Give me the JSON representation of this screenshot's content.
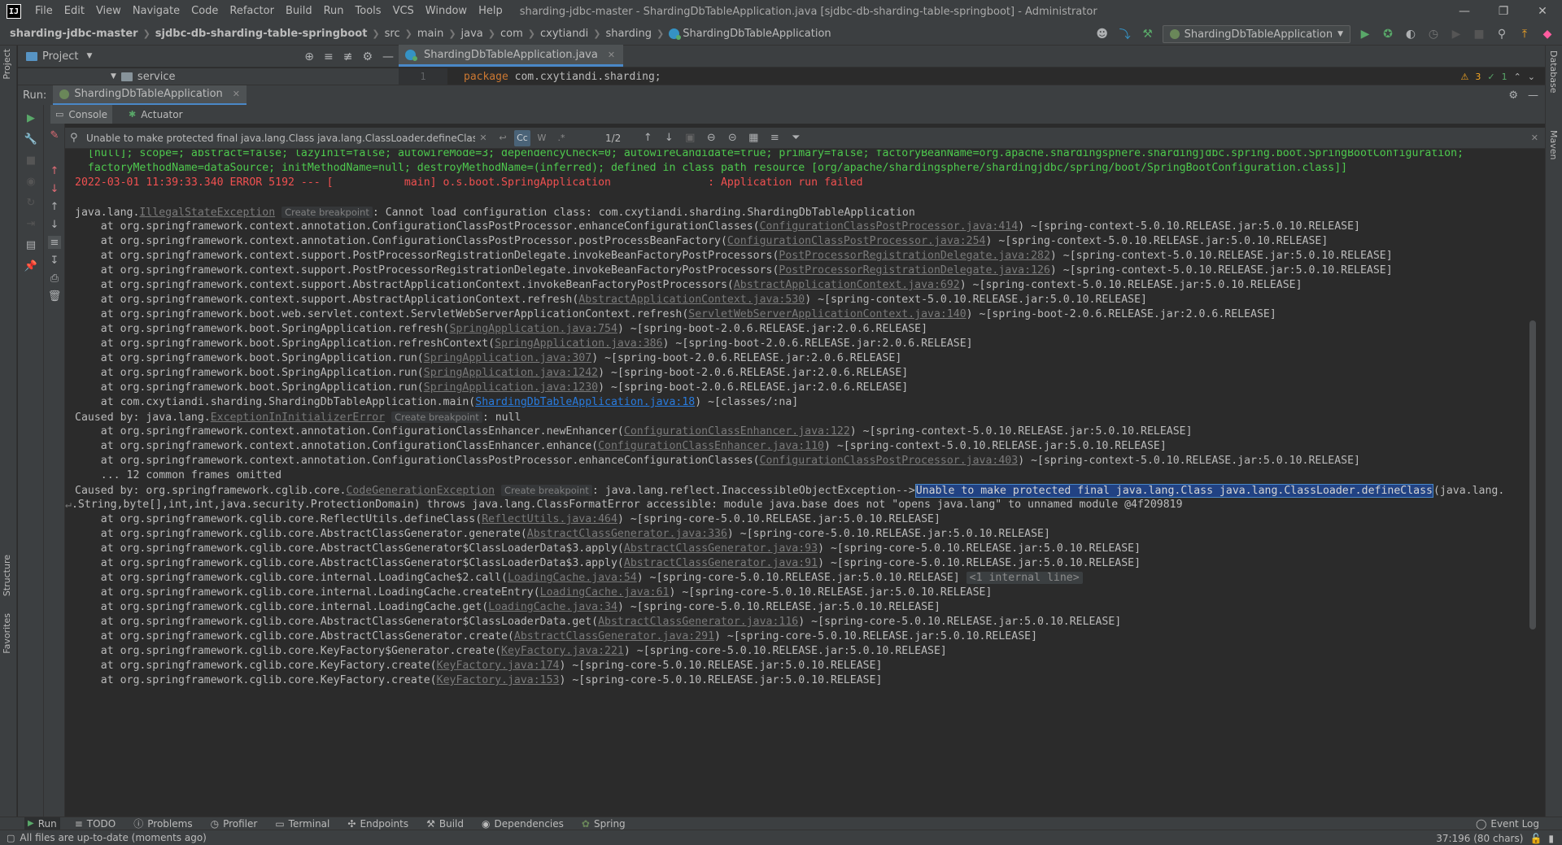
{
  "titlebar": {
    "logo": "IJ",
    "menu": [
      "File",
      "Edit",
      "View",
      "Navigate",
      "Code",
      "Refactor",
      "Build",
      "Run",
      "Tools",
      "VCS",
      "Window",
      "Help"
    ],
    "title": "sharding-jdbc-master - ShardingDbTableApplication.java [sjdbc-db-sharding-table-springboot] - Administrator"
  },
  "breadcrumb": {
    "items": [
      "sharding-jdbc-master",
      "sjdbc-db-sharding-table-springboot",
      "src",
      "main",
      "java",
      "com",
      "cxytiandi",
      "sharding",
      "ShardingDbTableApplication"
    ]
  },
  "run_config": {
    "label": "ShardingDbTableApplication"
  },
  "project_panel": {
    "title": "Project",
    "tree_item": "service"
  },
  "editor": {
    "tab": "ShardingDbTableApplication.java",
    "line_number": "1",
    "keyword": "package",
    "code": " com.cxytiandi.sharding;",
    "warnings": "3",
    "checks": "1"
  },
  "side_stripes": {
    "left": [
      "Project",
      "Structure",
      "Favorites"
    ],
    "right": [
      "Database",
      "Maven"
    ]
  },
  "run_window": {
    "title": "Run:",
    "tab": "ShardingDbTableApplication",
    "console_tab": "Console",
    "actuator_tab": "Actuator"
  },
  "search": {
    "value": "Unable to make protected final java.lang.Class java.lang.ClassLoader.defineClass",
    "match_case": "Cc",
    "words": "W",
    "regex": ".*",
    "count": "1/2"
  },
  "console": {
    "create_breakpoint": "Create breakpoint",
    "log_green_1": "  [null]; scope=; abstract=false; lazyInit=false; autowireMode=3; dependencyCheck=0; autowireCandidate=true; primary=false; factoryBeanName=org.apache.shardingsphere.shardingjdbc.spring.boot.SpringBootConfiguration;",
    "log_green_2": "  factoryMethodName=dataSource; initMethodName=null; destroyMethodName=(inferred); defined in class path resource [org/apache/shardingsphere/shardingjdbc/spring/boot/SpringBootConfiguration.class]]",
    "log_red": "2022-03-01 11:39:33.340 ERROR 5192 --- [           main] o.s.boot.SpringApplication               : Application run failed",
    "ex1_pre": "java.lang.",
    "ex1_name": "IllegalStateException",
    "ex1_post": ": Cannot load configuration class: com.cxytiandi.sharding.ShardingDbTableApplication",
    "trace1": [
      {
        "pre": "    at org.springframework.context.annotation.ConfigurationClassPostProcessor.enhanceConfigurationClasses(",
        "link": "ConfigurationClassPostProcessor.java:414",
        "post": ") ~[spring-context-5.0.10.RELEASE.jar:5.0.10.RELEASE]"
      },
      {
        "pre": "    at org.springframework.context.annotation.ConfigurationClassPostProcessor.postProcessBeanFactory(",
        "link": "ConfigurationClassPostProcessor.java:254",
        "post": ") ~[spring-context-5.0.10.RELEASE.jar:5.0.10.RELEASE]"
      },
      {
        "pre": "    at org.springframework.context.support.PostProcessorRegistrationDelegate.invokeBeanFactoryPostProcessors(",
        "link": "PostProcessorRegistrationDelegate.java:282",
        "post": ") ~[spring-context-5.0.10.RELEASE.jar:5.0.10.RELEASE]"
      },
      {
        "pre": "    at org.springframework.context.support.PostProcessorRegistrationDelegate.invokeBeanFactoryPostProcessors(",
        "link": "PostProcessorRegistrationDelegate.java:126",
        "post": ") ~[spring-context-5.0.10.RELEASE.jar:5.0.10.RELEASE]"
      },
      {
        "pre": "    at org.springframework.context.support.AbstractApplicationContext.invokeBeanFactoryPostProcessors(",
        "link": "AbstractApplicationContext.java:692",
        "post": ") ~[spring-context-5.0.10.RELEASE.jar:5.0.10.RELEASE]"
      },
      {
        "pre": "    at org.springframework.context.support.AbstractApplicationContext.refresh(",
        "link": "AbstractApplicationContext.java:530",
        "post": ") ~[spring-context-5.0.10.RELEASE.jar:5.0.10.RELEASE]"
      },
      {
        "pre": "    at org.springframework.boot.web.servlet.context.ServletWebServerApplicationContext.refresh(",
        "link": "ServletWebServerApplicationContext.java:140",
        "post": ") ~[spring-boot-2.0.6.RELEASE.jar:2.0.6.RELEASE]"
      },
      {
        "pre": "    at org.springframework.boot.SpringApplication.refresh(",
        "link": "SpringApplication.java:754",
        "post": ") ~[spring-boot-2.0.6.RELEASE.jar:2.0.6.RELEASE]"
      },
      {
        "pre": "    at org.springframework.boot.SpringApplication.refreshContext(",
        "link": "SpringApplication.java:386",
        "post": ") ~[spring-boot-2.0.6.RELEASE.jar:2.0.6.RELEASE]"
      },
      {
        "pre": "    at org.springframework.boot.SpringApplication.run(",
        "link": "SpringApplication.java:307",
        "post": ") ~[spring-boot-2.0.6.RELEASE.jar:2.0.6.RELEASE]"
      },
      {
        "pre": "    at org.springframework.boot.SpringApplication.run(",
        "link": "SpringApplication.java:1242",
        "post": ") ~[spring-boot-2.0.6.RELEASE.jar:2.0.6.RELEASE]"
      },
      {
        "pre": "    at org.springframework.boot.SpringApplication.run(",
        "link": "SpringApplication.java:1230",
        "post": ") ~[spring-boot-2.0.6.RELEASE.jar:2.0.6.RELEASE]"
      }
    ],
    "main_pre": "    at com.cxytiandi.sharding.ShardingDbTableApplication.main(",
    "main_link": "ShardingDbTableApplication.java:18",
    "main_post": ") ~[classes/:na]",
    "ex2_pre": "Caused by: java.lang.",
    "ex2_name": "ExceptionInInitializerError",
    "ex2_post": ": null",
    "trace2": [
      {
        "pre": "    at org.springframework.context.annotation.ConfigurationClassEnhancer.newEnhancer(",
        "link": "ConfigurationClassEnhancer.java:122",
        "post": ") ~[spring-context-5.0.10.RELEASE.jar:5.0.10.RELEASE]"
      },
      {
        "pre": "    at org.springframework.context.annotation.ConfigurationClassEnhancer.enhance(",
        "link": "ConfigurationClassEnhancer.java:110",
        "post": ") ~[spring-context-5.0.10.RELEASE.jar:5.0.10.RELEASE]"
      },
      {
        "pre": "    at org.springframework.context.annotation.ConfigurationClassPostProcessor.enhanceConfigurationClasses(",
        "link": "ConfigurationClassPostProcessor.java:403",
        "post": ") ~[spring-context-5.0.10.RELEASE.jar:5.0.10.RELEASE]"
      }
    ],
    "omitted": "    ... 12 common frames omitted",
    "ex3_pre": "Caused by: org.springframework.cglib.core.",
    "ex3_name": "CodeGenerationException",
    "ex3_mid": ": java.lang.reflect.InaccessibleObjectException-->",
    "ex3_highlight": "Unable to make protected final java.lang.Class java.lang.ClassLoader.defineClass",
    "ex3_post": "(java.lang.",
    "ex3_wrap": ".String,byte[],int,int,java.security.ProtectionDomain) throws java.lang.ClassFormatError accessible: module java.base does not \"opens java.lang\" to unnamed module @4f209819",
    "trace3": [
      {
        "pre": "    at org.springframework.cglib.core.ReflectUtils.defineClass(",
        "link": "ReflectUtils.java:464",
        "post": ") ~[spring-core-5.0.10.RELEASE.jar:5.0.10.RELEASE]"
      },
      {
        "pre": "    at org.springframework.cglib.core.AbstractClassGenerator.generate(",
        "link": "AbstractClassGenerator.java:336",
        "post": ") ~[spring-core-5.0.10.RELEASE.jar:5.0.10.RELEASE]"
      },
      {
        "pre": "    at org.springframework.cglib.core.AbstractClassGenerator$ClassLoaderData$3.apply(",
        "link": "AbstractClassGenerator.java:93",
        "post": ") ~[spring-core-5.0.10.RELEASE.jar:5.0.10.RELEASE]"
      },
      {
        "pre": "    at org.springframework.cglib.core.AbstractClassGenerator$ClassLoaderData$3.apply(",
        "link": "AbstractClassGenerator.java:91",
        "post": ") ~[spring-core-5.0.10.RELEASE.jar:5.0.10.RELEASE]"
      },
      {
        "pre": "    at org.springframework.cglib.core.internal.LoadingCache$2.call(",
        "link": "LoadingCache.java:54",
        "post": ") ~[spring-core-5.0.10.RELEASE.jar:5.0.10.RELEASE] ",
        "fold": "<1 internal line>"
      },
      {
        "pre": "    at org.springframework.cglib.core.internal.LoadingCache.createEntry(",
        "link": "LoadingCache.java:61",
        "post": ") ~[spring-core-5.0.10.RELEASE.jar:5.0.10.RELEASE]"
      },
      {
        "pre": "    at org.springframework.cglib.core.internal.LoadingCache.get(",
        "link": "LoadingCache.java:34",
        "post": ") ~[spring-core-5.0.10.RELEASE.jar:5.0.10.RELEASE]"
      },
      {
        "pre": "    at org.springframework.cglib.core.AbstractClassGenerator$ClassLoaderData.get(",
        "link": "AbstractClassGenerator.java:116",
        "post": ") ~[spring-core-5.0.10.RELEASE.jar:5.0.10.RELEASE]"
      },
      {
        "pre": "    at org.springframework.cglib.core.AbstractClassGenerator.create(",
        "link": "AbstractClassGenerator.java:291",
        "post": ") ~[spring-core-5.0.10.RELEASE.jar:5.0.10.RELEASE]"
      },
      {
        "pre": "    at org.springframework.cglib.core.KeyFactory$Generator.create(",
        "link": "KeyFactory.java:221",
        "post": ") ~[spring-core-5.0.10.RELEASE.jar:5.0.10.RELEASE]"
      },
      {
        "pre": "    at org.springframework.cglib.core.KeyFactory.create(",
        "link": "KeyFactory.java:174",
        "post": ") ~[spring-core-5.0.10.RELEASE.jar:5.0.10.RELEASE]"
      },
      {
        "pre": "    at org.springframework.cglib.core.KeyFactory.create(",
        "link": "KeyFactory.java:153",
        "post": ") ~[spring-core-5.0.10.RELEASE.jar:5.0.10.RELEASE]"
      }
    ]
  },
  "bottom_tabs": [
    "Run",
    "TODO",
    "Problems",
    "Profiler",
    "Terminal",
    "Endpoints",
    "Build",
    "Dependencies",
    "Spring"
  ],
  "event_log": "Event Log",
  "status": {
    "message": "All files are up-to-date (moments ago)",
    "position": "37:196 (80 chars)"
  }
}
